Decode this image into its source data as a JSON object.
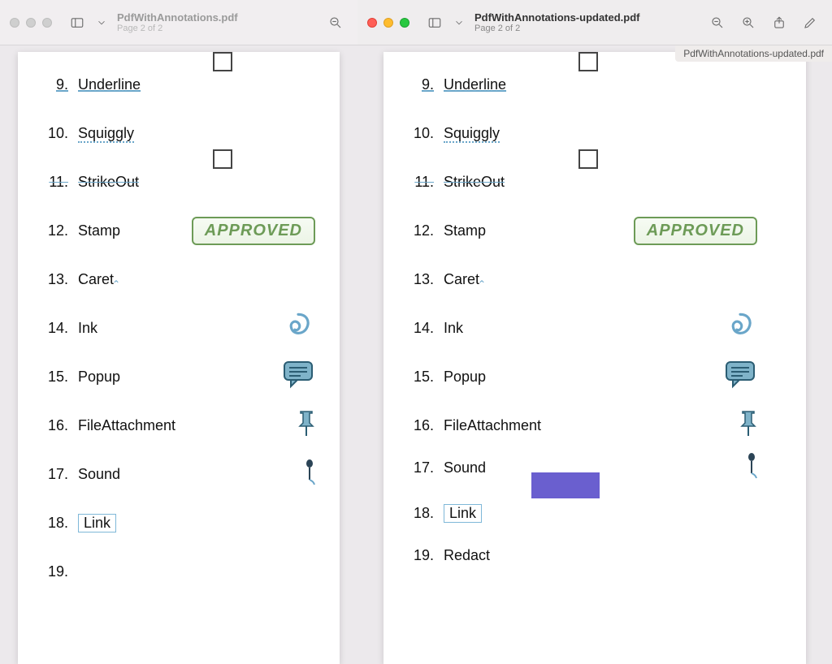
{
  "left": {
    "title": "PdfWithAnnotations.pdf",
    "subtitle": "Page 2 of 2"
  },
  "right": {
    "title": "PdfWithAnnotations-updated.pdf",
    "subtitle": "Page 2 of 2",
    "banner": "PdfWithAnnotations-updated.pdf"
  },
  "stamp_text": "APPROVED",
  "items": [
    {
      "n": "9.",
      "label": "Underline",
      "style": "underline"
    },
    {
      "n": "10.",
      "label": "Squiggly",
      "style": "squiggly"
    },
    {
      "n": "11.",
      "label": "StrikeOut",
      "style": "strike"
    },
    {
      "n": "12.",
      "label": "Stamp",
      "style": ""
    },
    {
      "n": "13.",
      "label": "Caret",
      "style": ""
    },
    {
      "n": "14.",
      "label": "Ink",
      "style": ""
    },
    {
      "n": "15.",
      "label": "Popup",
      "style": ""
    },
    {
      "n": "16.",
      "label": "FileAttachment",
      "style": ""
    },
    {
      "n": "17.",
      "label": "Sound",
      "style": ""
    },
    {
      "n": "18.",
      "label": "Link",
      "style": "linkbox"
    },
    {
      "n": "19.",
      "label": "Redact",
      "style": ""
    }
  ],
  "left_redact_visible": false
}
